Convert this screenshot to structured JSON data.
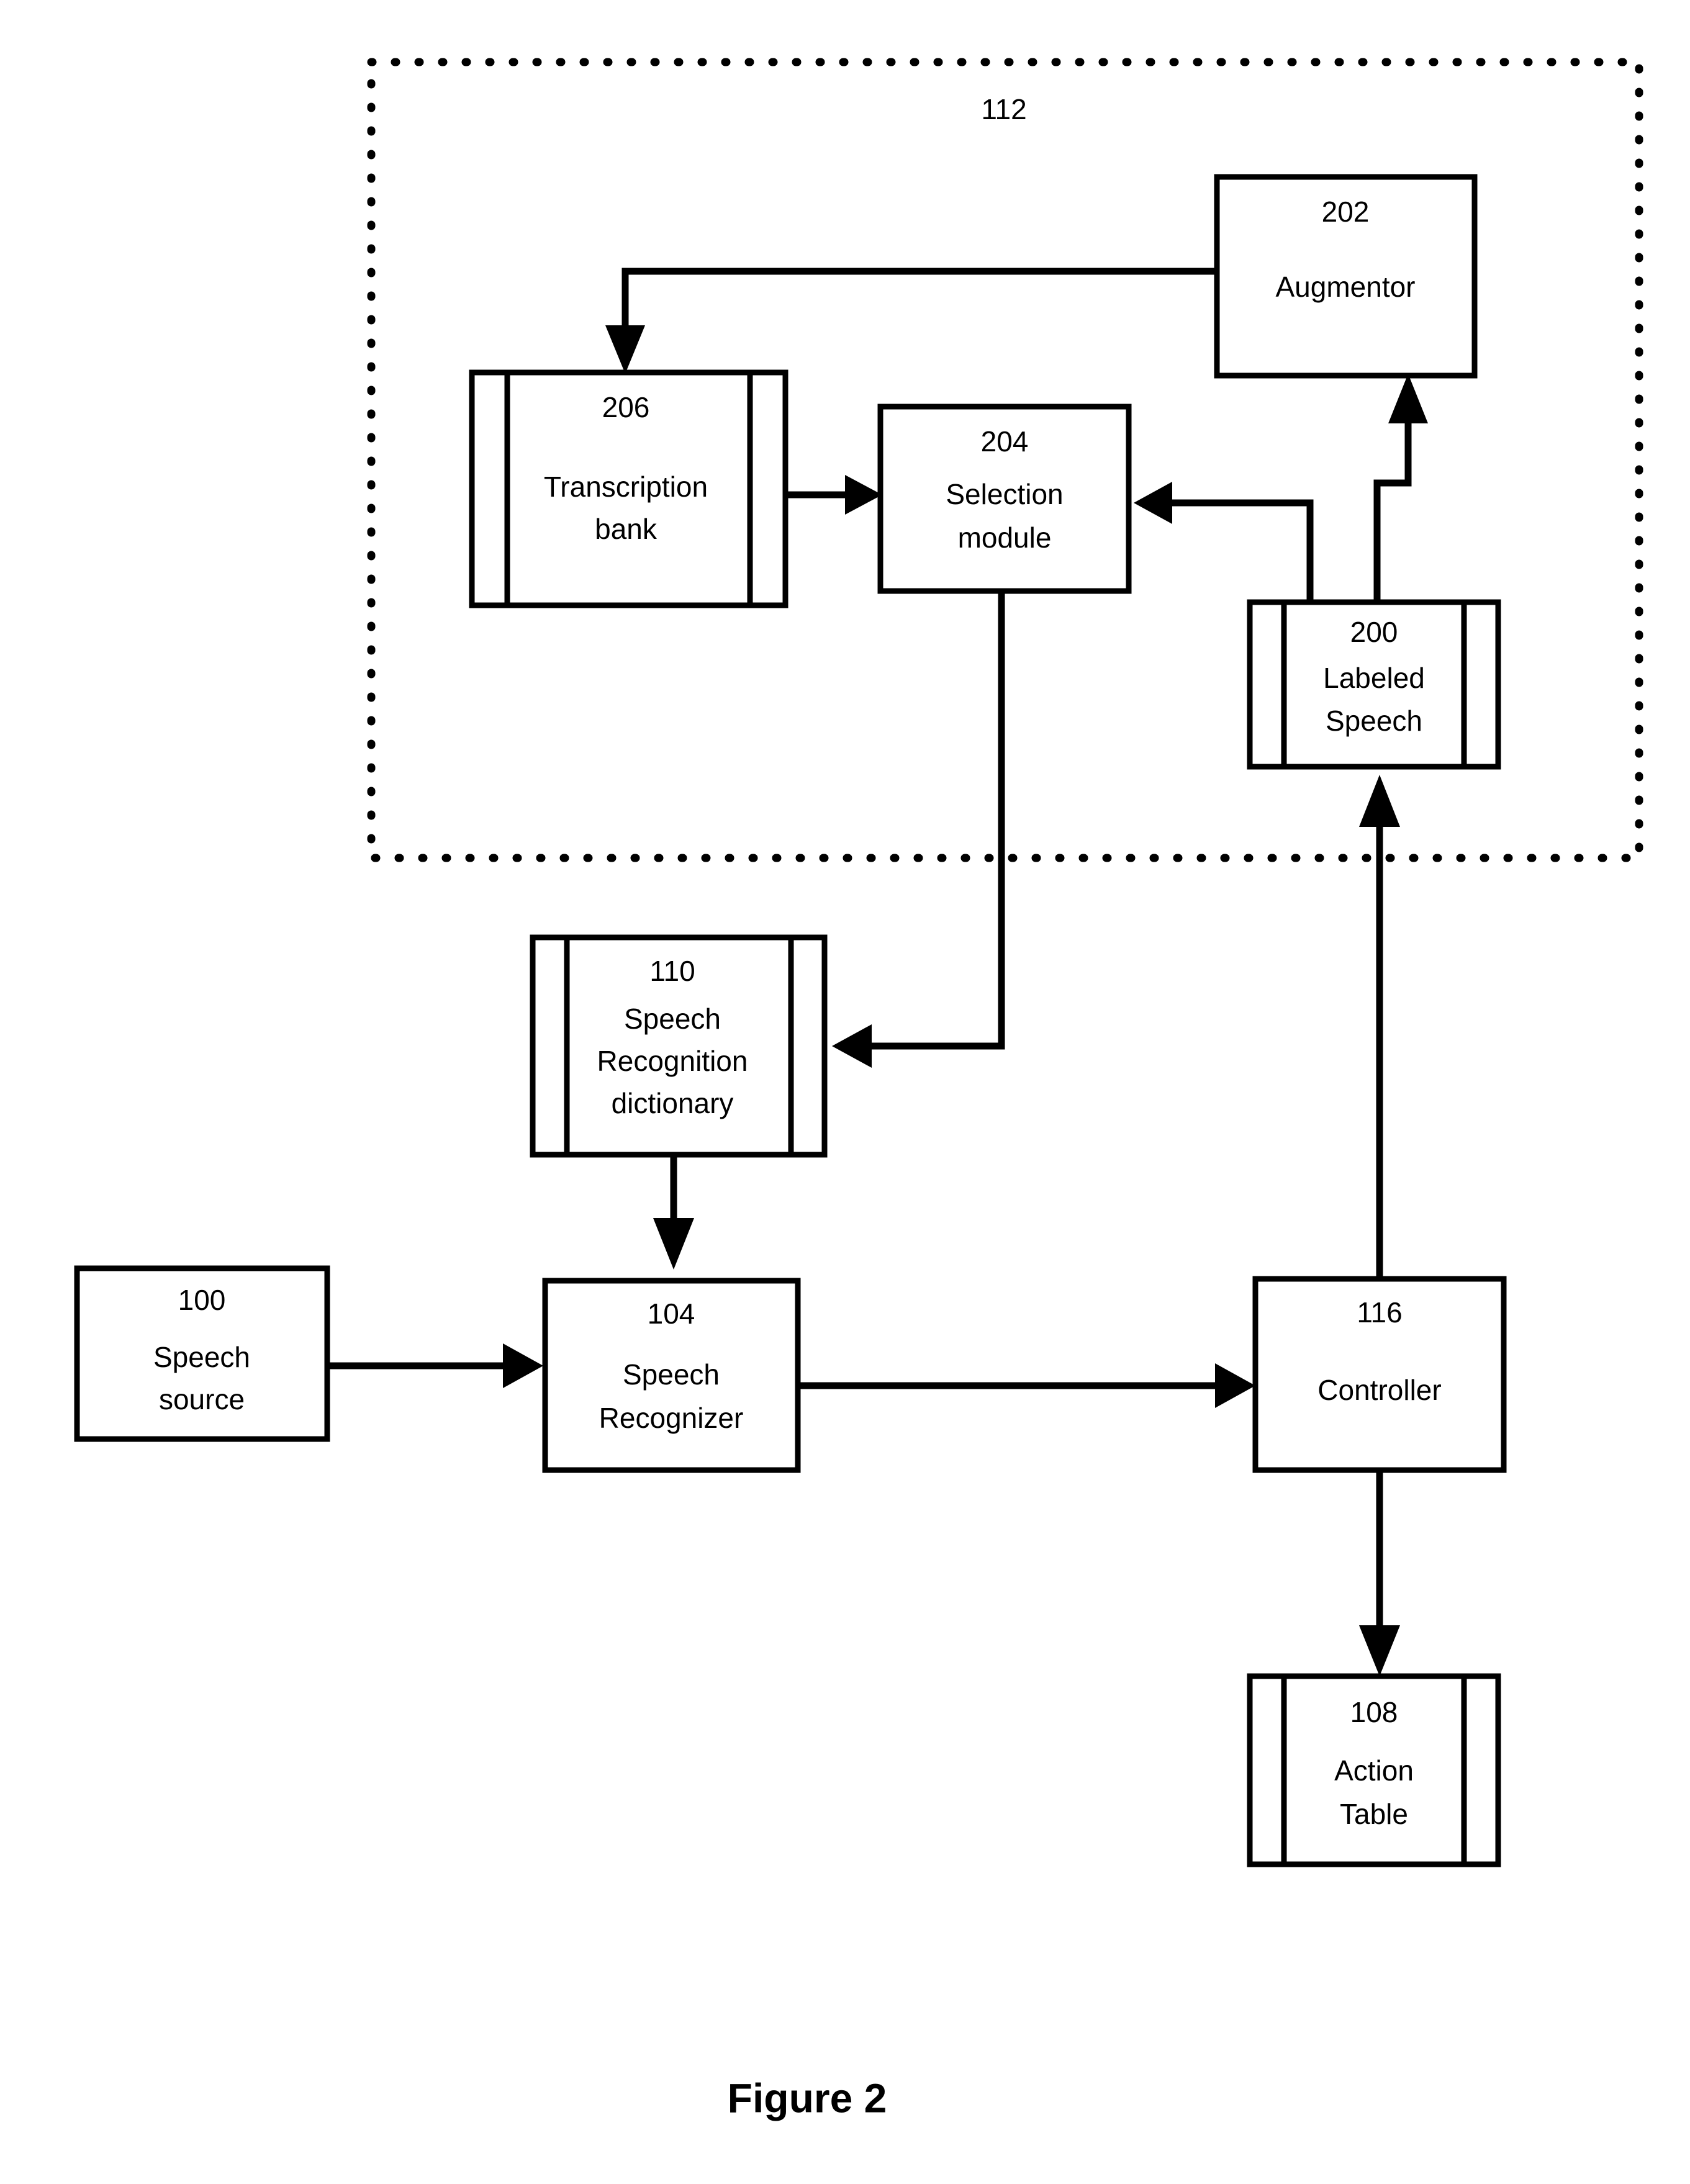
{
  "figure": {
    "caption": "Figure 2",
    "container": {
      "ref": "112",
      "style": "dotted-boundary"
    }
  },
  "blocks": [
    {
      "id": "augmentor",
      "ref": "202",
      "label": "Augmentor",
      "shape": "rect"
    },
    {
      "id": "transcription-bank",
      "ref": "206",
      "label_line1": "Transcription",
      "label_line2": "bank",
      "shape": "database"
    },
    {
      "id": "selection-module",
      "ref": "204",
      "label_line1": "Selection",
      "label_line2": "module",
      "shape": "rect"
    },
    {
      "id": "labeled-speech",
      "ref": "200",
      "label_line1": "Labeled",
      "label_line2": "Speech",
      "shape": "database"
    },
    {
      "id": "speech-recognition-dictionary",
      "ref": "110",
      "label_line1": "Speech",
      "label_line2": "Recognition",
      "label_line3": "dictionary",
      "shape": "database"
    },
    {
      "id": "speech-source",
      "ref": "100",
      "label_line1": "Speech",
      "label_line2": "source",
      "shape": "rect"
    },
    {
      "id": "speech-recognizer",
      "ref": "104",
      "label_line1": "Speech",
      "label_line2": "Recognizer",
      "shape": "rect"
    },
    {
      "id": "controller",
      "ref": "116",
      "label": "Controller",
      "shape": "rect"
    },
    {
      "id": "action-table",
      "ref": "108",
      "label_line1": "Action",
      "label_line2": "Table",
      "shape": "database"
    }
  ],
  "connections": [
    {
      "from": "augmentor",
      "to": "transcription-bank",
      "arrow": "down"
    },
    {
      "from": "transcription-bank",
      "to": "selection-module",
      "arrow": "right"
    },
    {
      "from": "labeled-speech",
      "to": "selection-module",
      "arrow": "left"
    },
    {
      "from": "labeled-speech",
      "to": "augmentor",
      "arrow": "up"
    },
    {
      "from": "selection-module",
      "to": "speech-recognition-dictionary",
      "arrow": "left"
    },
    {
      "from": "speech-recognition-dictionary",
      "to": "speech-recognizer",
      "arrow": "down"
    },
    {
      "from": "speech-source",
      "to": "speech-recognizer",
      "arrow": "right"
    },
    {
      "from": "speech-recognizer",
      "to": "controller",
      "arrow": "right"
    },
    {
      "from": "controller",
      "to": "action-table",
      "arrow": "down"
    },
    {
      "from": "controller",
      "to": "labeled-speech",
      "arrow": "up"
    }
  ],
  "colors": {
    "stroke": "#000000",
    "background": "#ffffff"
  }
}
